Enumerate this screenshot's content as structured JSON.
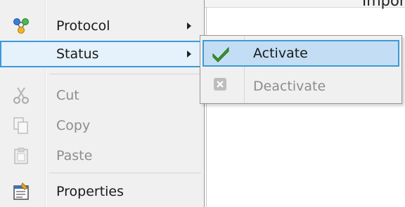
{
  "background": {
    "header_text": "Impor"
  },
  "menu": {
    "items": [
      {
        "label": "Protocol",
        "icon": "protocol-icon",
        "has_submenu": true,
        "enabled": true
      },
      {
        "label": "Status",
        "icon": "",
        "has_submenu": true,
        "enabled": true,
        "highlighted": true
      },
      {
        "label": "Cut",
        "icon": "scissors-icon",
        "enabled": false
      },
      {
        "label": "Copy",
        "icon": "copy-icon",
        "enabled": false
      },
      {
        "label": "Paste",
        "icon": "paste-icon",
        "enabled": false
      },
      {
        "label": "Properties",
        "icon": "properties-icon",
        "enabled": true
      }
    ]
  },
  "submenu": {
    "items": [
      {
        "label": "Activate",
        "icon": "checkmark-icon",
        "enabled": true,
        "highlighted": true
      },
      {
        "label": "Deactivate",
        "icon": "x-box-icon",
        "enabled": false
      }
    ]
  },
  "colors": {
    "highlight_border": "#3d9ad8",
    "highlight_fill": "#c3def4",
    "menu_background": "#f0f0f0",
    "checkmark_green": "#3a9a2c"
  }
}
